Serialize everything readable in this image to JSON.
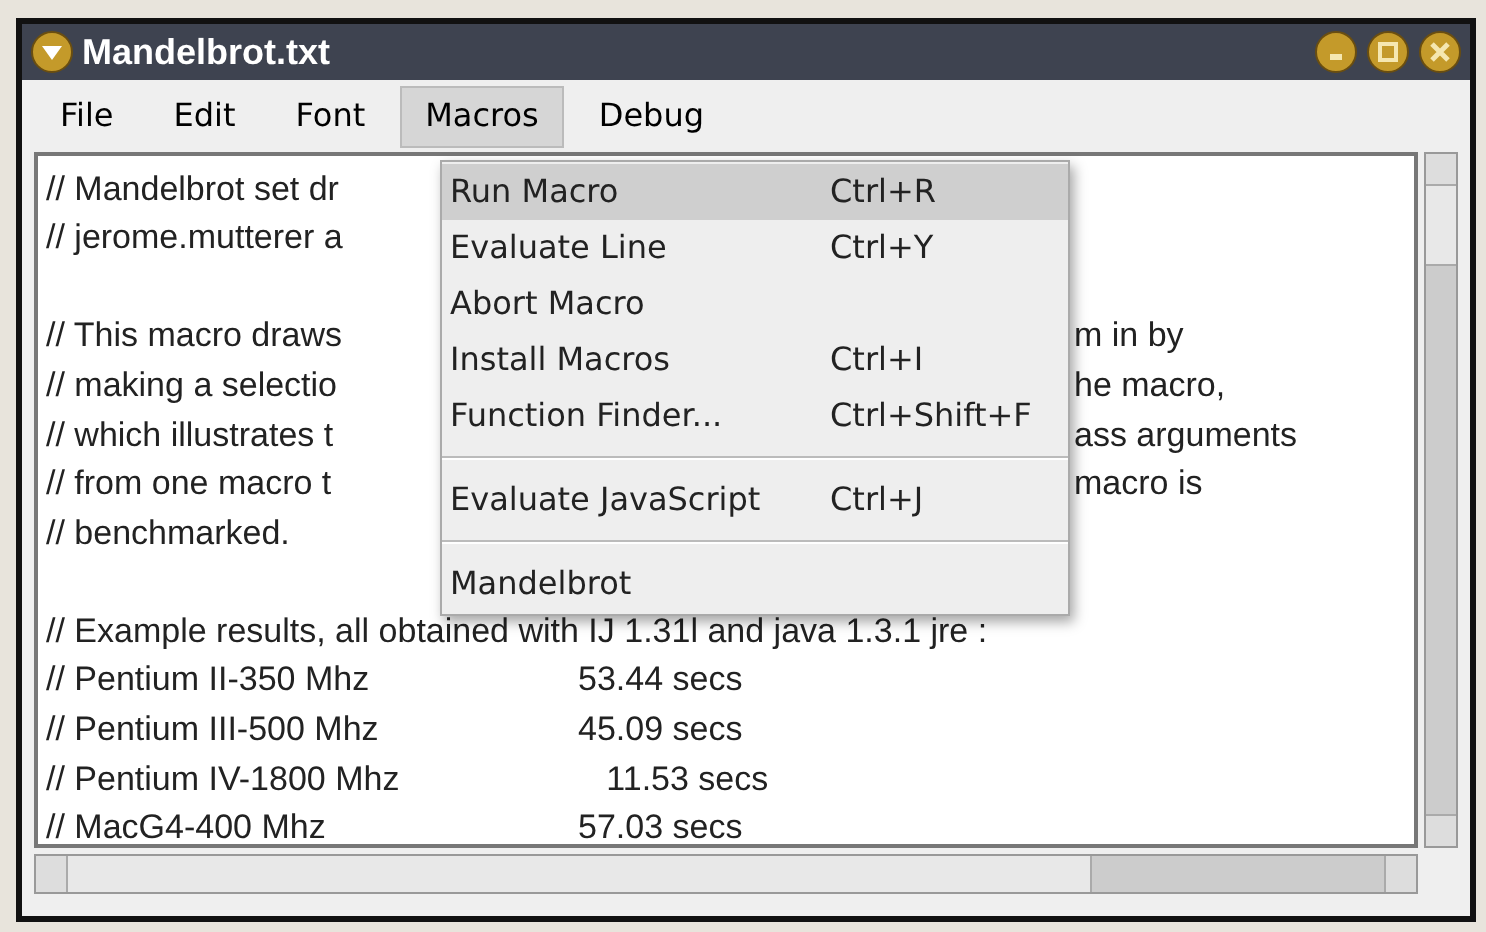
{
  "window": {
    "title": "Mandelbrot.txt"
  },
  "menu_bar": [
    {
      "label": "File",
      "selected": false
    },
    {
      "label": "Edit",
      "selected": false
    },
    {
      "label": "Font",
      "selected": false
    },
    {
      "label": "Macros",
      "selected": true
    },
    {
      "label": "Debug",
      "selected": false
    }
  ],
  "editor_lines": [
    {
      "kind": "code",
      "left": "// Mandelbrot set dr"
    },
    {
      "kind": "code",
      "left": "// jerome.mutterer a"
    },
    {
      "kind": "blank"
    },
    {
      "kind": "code",
      "left": "// This macro draws",
      "right": "m in by"
    },
    {
      "kind": "code",
      "left": "// making a selectio",
      "right": "he macro,"
    },
    {
      "kind": "code",
      "left": "// which illustrates t",
      "right": "ass arguments"
    },
    {
      "kind": "code",
      "left": "// from one macro t",
      "right": "macro is"
    },
    {
      "kind": "code",
      "left": "// benchmarked."
    },
    {
      "kind": "blank"
    },
    {
      "kind": "code",
      "left": "// Example results, all obtained with IJ 1.31l and java 1.3.1 jre :"
    },
    {
      "kind": "code",
      "left": "// Pentium II-350 Mhz",
      "tail": "53.44 secs"
    },
    {
      "kind": "code",
      "left": "// Pentium III-500 Mhz",
      "tail": "45.09 secs"
    },
    {
      "kind": "code",
      "left": "// Pentium IV-1800 Mhz",
      "tail": "   11.53 secs"
    },
    {
      "kind": "code",
      "left": "// MacG4-400 Mhz",
      "tail": "57.03 secs"
    }
  ],
  "macros_menu": [
    {
      "kind": "item",
      "label": "Run Macro",
      "shortcut": "Ctrl+R",
      "selected": true
    },
    {
      "kind": "item",
      "label": "Evaluate Line",
      "shortcut": "Ctrl+Y",
      "selected": false
    },
    {
      "kind": "item",
      "label": "Abort Macro",
      "selected": false
    },
    {
      "kind": "item",
      "label": "Install Macros",
      "shortcut": "Ctrl+I",
      "selected": false
    },
    {
      "kind": "item",
      "label": "Function Finder...",
      "shortcut": "Ctrl+Shift+F",
      "selected": false
    },
    {
      "kind": "separator"
    },
    {
      "kind": "item",
      "label": "Evaluate JavaScript",
      "shortcut": "Ctrl+J",
      "selected": false
    },
    {
      "kind": "separator"
    },
    {
      "kind": "item",
      "label": "Mandelbrot",
      "selected": false
    }
  ]
}
